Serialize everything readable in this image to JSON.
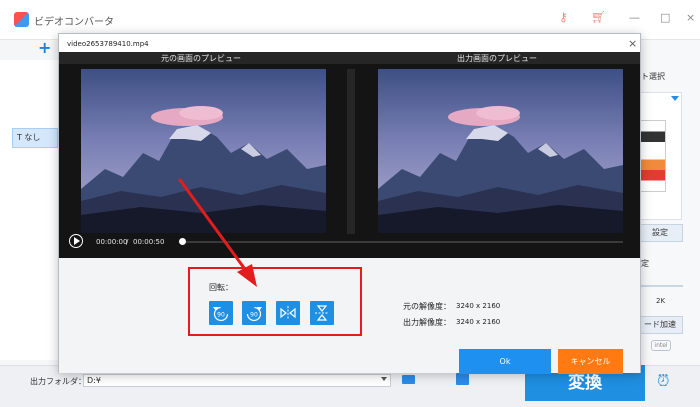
{
  "app": {
    "title": "ビデオコンバータ",
    "add_glyph": "+",
    "text_chip": "T なし",
    "format_select": "ト選択",
    "settings_button": "設定",
    "resolution_section": "定",
    "resolution_value": "2K",
    "hw_accel_button": "ード加速",
    "intel_badge": "intel",
    "output_folder_label": "出力フォルダ：",
    "output_folder_value": "D:¥",
    "convert_button": "変換",
    "icons": [
      "key-icon",
      "cart-icon",
      "minimize-icon",
      "maximize-icon",
      "close-icon",
      "folder-icon",
      "open-folder-icon",
      "alarm-icon"
    ]
  },
  "dialog": {
    "title": "video2653789410.mp4",
    "close_glyph": "×",
    "preview_original_label": "元の画面のプレビュー",
    "preview_output_label": "出力画面のプレビュー",
    "time_current": "00:00:00",
    "time_separator": "/",
    "time_total": "00:00:50",
    "playback_progress": 0,
    "rotate_label": "回転：",
    "rotate_buttons": [
      {
        "name": "rotate-left-90",
        "text": "90"
      },
      {
        "name": "rotate-right-90",
        "text": "90"
      },
      {
        "name": "flip-horizontal",
        "text": ""
      },
      {
        "name": "flip-vertical",
        "text": ""
      }
    ],
    "original_resolution_label": "元の解像度：",
    "original_resolution_value": "3240 x 2160",
    "output_resolution_label": "出力解像度：",
    "output_resolution_value": "3240 x 2160",
    "ok_button": "Ok",
    "cancel_button": "キャンセル"
  },
  "colors": {
    "accent": "#1e8fe1",
    "cancel": "#ff7a12",
    "highlight": "#e31d1d"
  }
}
